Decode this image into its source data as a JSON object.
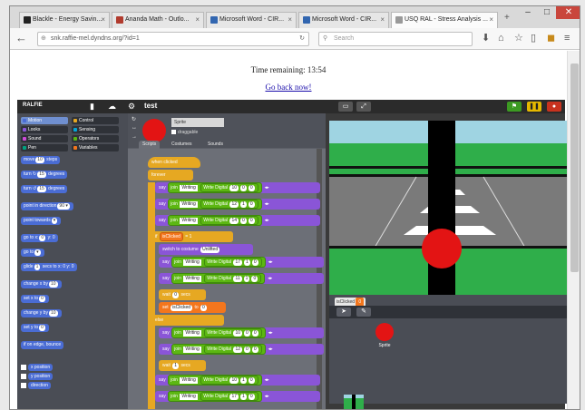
{
  "browser": {
    "tabs": [
      {
        "title": "Blackle - Energy Savin...",
        "fav": "#222"
      },
      {
        "title": "Ananda Math - Outlo...",
        "fav": "#b13b2e"
      },
      {
        "title": "Microsoft Word - CIR...",
        "fav": "#3266b0"
      },
      {
        "title": "Microsoft Word - CIR...",
        "fav": "#3266b0"
      },
      {
        "title": "USQ RAL - Stress Analysis ...",
        "fav": "#999"
      }
    ],
    "newtab": "+",
    "window_buttons": {
      "minimize": "–",
      "maximize": "□",
      "close": "✕"
    },
    "url": "snk.raffie-mel.dyndns.org/?id=1",
    "search_placeholder": "Search",
    "icons": {
      "back": "back-arrow-icon",
      "reload": "reload-icon",
      "download": "download-icon",
      "home": "home-icon",
      "bookmark": "star-icon",
      "menu": "hamburger-menu-icon"
    }
  },
  "page": {
    "timer": "Time remaining: 13:54",
    "go_back": "Go back now!"
  },
  "ide": {
    "logo": "RALFIE",
    "project": "test",
    "categories": [
      {
        "label": "Motion",
        "color": "#4a6cd4",
        "selected": true
      },
      {
        "label": "Control",
        "color": "#e6a822",
        "selected": false
      },
      {
        "label": "Looks",
        "color": "#8a55d7",
        "selected": false
      },
      {
        "label": "Sensing",
        "color": "#04a6d8",
        "selected": false
      },
      {
        "label": "Sound",
        "color": "#cf4ad9",
        "selected": false
      },
      {
        "label": "Operators",
        "color": "#5cb712",
        "selected": false
      },
      {
        "label": "Pen",
        "color": "#00a180",
        "selected": false
      },
      {
        "label": "Variables",
        "color": "#f3761d",
        "selected": false
      }
    ],
    "motion_blocks": [
      {
        "pre": "move",
        "slot": "10",
        "post": "steps"
      },
      {
        "pre": "turn ↻",
        "slot": "15",
        "post": "degrees"
      },
      {
        "pre": "turn ↺",
        "slot": "15",
        "post": "degrees"
      },
      {
        "pre": "point in direction",
        "slot": "90 ▾",
        "post": ""
      },
      {
        "pre": "point towards",
        "slot": "▾",
        "post": ""
      },
      {
        "pre": "go to x:",
        "slot": "0",
        "post": "y: 0"
      },
      {
        "pre": "go to",
        "slot": "▾",
        "post": ""
      },
      {
        "pre": "glide",
        "slot": "1",
        "post": "secs to x: 0 y: 0"
      },
      {
        "pre": "change x by",
        "slot": "10",
        "post": ""
      },
      {
        "pre": "set x to",
        "slot": "0",
        "post": ""
      },
      {
        "pre": "change y by",
        "slot": "10",
        "post": ""
      },
      {
        "pre": "set y to",
        "slot": "0",
        "post": ""
      },
      {
        "pre": "if on edge, bounce",
        "slot": "",
        "post": ""
      }
    ],
    "reporters": [
      "x position",
      "y position",
      "direction"
    ],
    "sprite": {
      "name": "Sprite",
      "draggable": "draggable",
      "tabs": [
        "Scripts",
        "Costumes",
        "Sounds"
      ]
    },
    "scripts": {
      "hat": "when clicked",
      "forever": "forever",
      "say": "say",
      "join": "join",
      "writing": "Writing",
      "write_digital": "Write Digital",
      "pin_rows_a": [
        [
          "10",
          "0",
          "0"
        ],
        [
          "12",
          "1",
          "0"
        ],
        [
          "14",
          "0",
          "0"
        ]
      ],
      "if_label": "if",
      "if_var": "isClicked",
      "if_eq": "= 1",
      "switch_costume": "switch to costume",
      "costume": "Unlifted",
      "pin_rows_b": [
        [
          "17",
          "1",
          "0"
        ],
        [
          "11",
          "1",
          "0"
        ]
      ],
      "wait": "wait",
      "wait_val": "0",
      "wait_unit": "secs",
      "set_label": "set",
      "set_var": "isClicked",
      "set_to": "to",
      "set_val": "0",
      "else_label": "else",
      "pin_rows_c": [
        [
          "10",
          "0",
          "0"
        ],
        [
          "12",
          "0",
          "0"
        ]
      ],
      "wait2_val": "1",
      "pin_rows_d": [
        [
          "10",
          "1",
          "0"
        ],
        [
          "17",
          "1",
          "0"
        ],
        [
          "12",
          "0",
          "0"
        ],
        [
          "14",
          "0",
          "0"
        ]
      ]
    },
    "watcher": {
      "label": "isClicked",
      "value": "0"
    },
    "sprite_corral_label": "Sprite",
    "colors": {
      "stage_sky": "#9fd4e2",
      "stage_grass": "#2fae4a",
      "road": "#7a7a7a",
      "pole": "#000000",
      "ball": "#e31414"
    }
  }
}
